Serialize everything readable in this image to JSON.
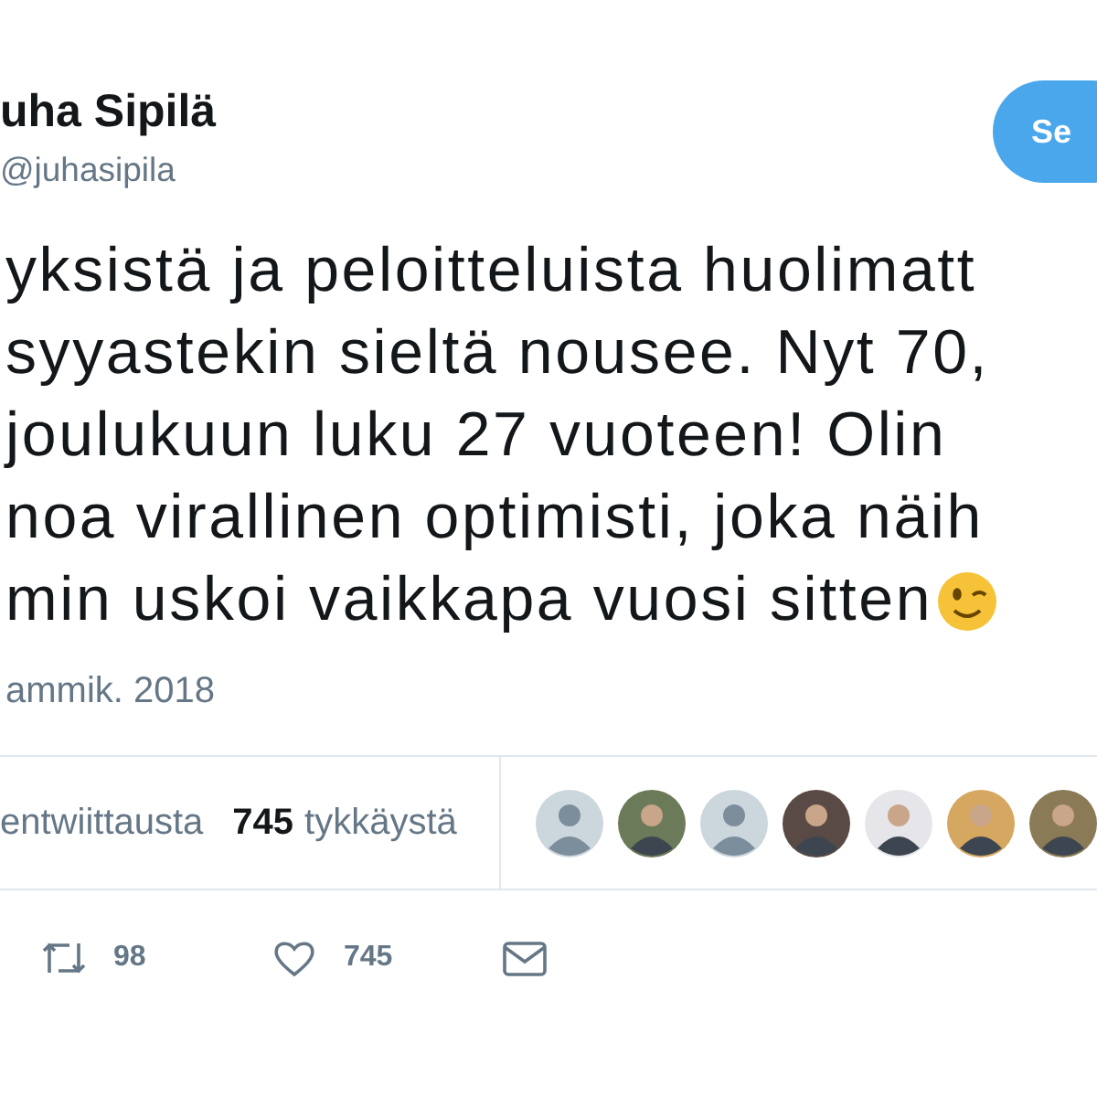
{
  "author": {
    "name": "uha Sipilä",
    "handle": "@juhasipila"
  },
  "follow_button": {
    "label": "Se"
  },
  "text_lines": [
    "yksistä ja peloitteluista huolimatt",
    "syyastekin sieltä nousee. Nyt 70,",
    "joulukuun luku 27 vuoteen! Olin",
    "noa virallinen optimisti, joka näih",
    "min uskoi vaikkapa vuosi sitten"
  ],
  "date": "ammik. 2018",
  "stats": [
    {
      "label": "entwiittausta"
    },
    {
      "count": "745",
      "label": "tykkäystä"
    }
  ],
  "likers": [
    {
      "kind": "default"
    },
    {
      "kind": "photo",
      "color": "#6b7a58"
    },
    {
      "kind": "default"
    },
    {
      "kind": "photo",
      "color": "#5a4a45"
    },
    {
      "kind": "photo",
      "color": "#e6e6ea"
    },
    {
      "kind": "photo",
      "color": "#d6a760"
    },
    {
      "kind": "photo",
      "color": "#8a7a55"
    }
  ],
  "actions": [
    {
      "kind": "retweet",
      "count": "98"
    },
    {
      "kind": "like",
      "count": "745"
    },
    {
      "kind": "message"
    }
  ]
}
